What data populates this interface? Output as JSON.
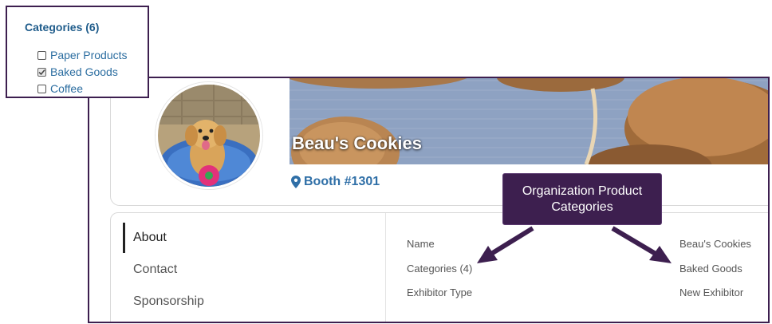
{
  "filter": {
    "title": "Categories (6)",
    "items": [
      {
        "label": "Paper Products",
        "checked": false
      },
      {
        "label": "Baked Goods",
        "checked": true
      },
      {
        "label": "Coffee",
        "checked": false
      }
    ]
  },
  "profile": {
    "name": "Beau's Cookies",
    "booth": "Booth #1301"
  },
  "tabs": [
    "About",
    "Contact",
    "Sponsorship"
  ],
  "fields": [
    {
      "label": "Name",
      "value": "Beau's Cookies"
    },
    {
      "label": "Categories (4)",
      "value": "Baked Goods"
    },
    {
      "label": "Exhibitor Type",
      "value": "New Exhibitor"
    }
  ],
  "callout": {
    "line1": "Organization Product",
    "line2": "Categories"
  },
  "colors": {
    "frame": "#3d1f4f",
    "accent": "#2f6fa7",
    "filter_text": "#2b6da0"
  },
  "icons": [
    "checkmark-icon",
    "map-pin-icon",
    "arrow-icon"
  ]
}
